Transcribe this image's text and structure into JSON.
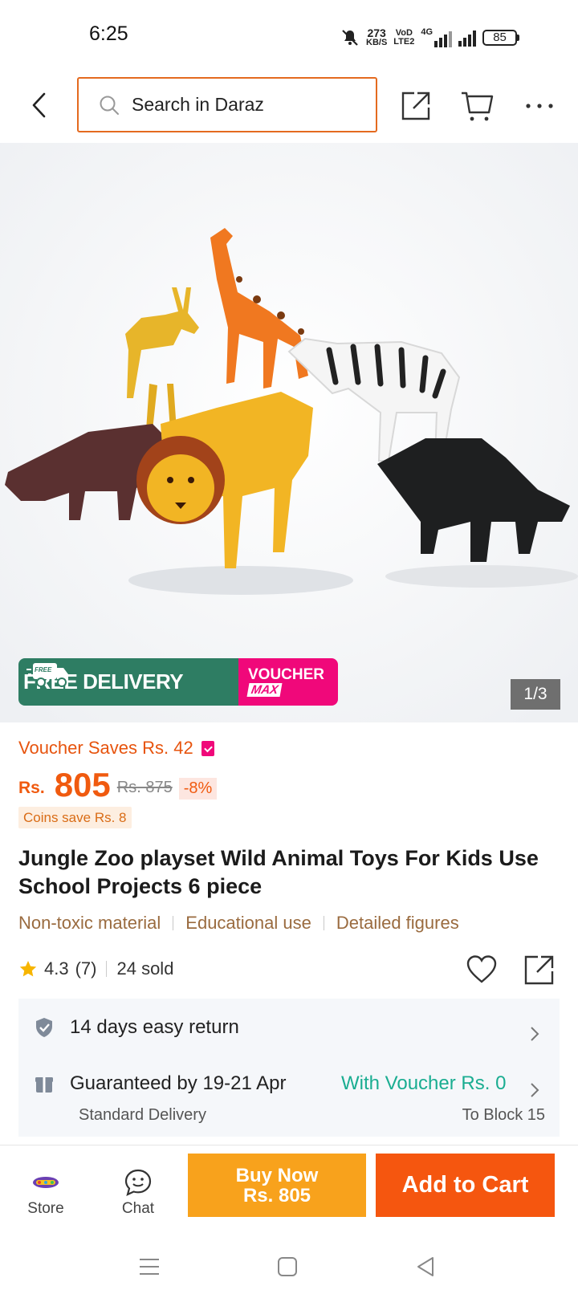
{
  "status_bar": {
    "time": "6:25",
    "speed_value": "273",
    "speed_unit": "KB/S",
    "volte_top": "VoD",
    "volte_bottom": "LTE2",
    "network": "4G",
    "battery": "85"
  },
  "header": {
    "search_placeholder": "Search in Daraz",
    "icons": [
      "back-arrow-icon",
      "search-icon",
      "share-icon",
      "cart-icon",
      "more-icon"
    ]
  },
  "gallery": {
    "page_indicator": "1/3",
    "promo": {
      "free_badge": "FREE",
      "free_label": "FREE DELIVERY",
      "voucher_top": "VOUCHER",
      "voucher_bottom": "MAX"
    },
    "colors": {
      "free_green": "#2e7d63",
      "voucher_pink": "#f0087a"
    }
  },
  "pricing": {
    "voucher_saves": "Voucher Saves Rs. 42",
    "currency": "Rs.",
    "price": "805",
    "original_price": "Rs. 875",
    "discount": "-8%",
    "coins_save": "Coins save Rs. 8",
    "accent_color": "#f05a0f"
  },
  "product": {
    "title": "Jungle Zoo playset Wild Animal Toys For Kids Use School Projects 6 piece",
    "features": [
      "Non-toxic material",
      "Educational use",
      "Detailed figures"
    ],
    "rating": "4.3",
    "rating_count": "(7)",
    "sold": "24 sold"
  },
  "services": {
    "return_policy": "14 days easy return",
    "delivery_guarantee": "Guaranteed by 19-21 Apr",
    "voucher_offer": "With Voucher Rs. 0",
    "delivery_type": "Standard Delivery",
    "delivery_location": "To Block 15"
  },
  "action_bar": {
    "store_label": "Store",
    "chat_label": "Chat",
    "buy_now_label": "Buy Now",
    "buy_now_price": "Rs. 805",
    "add_to_cart_label": "Add to Cart"
  }
}
